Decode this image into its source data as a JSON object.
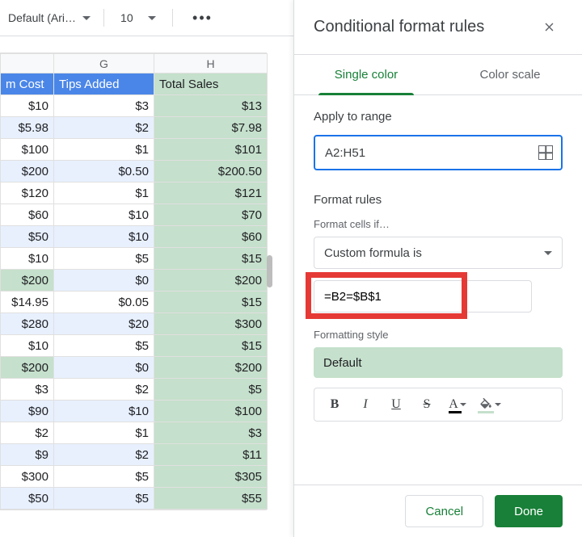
{
  "toolbar": {
    "font_label": "Default (Ari…",
    "font_size": "10"
  },
  "sheet": {
    "columns": [
      "",
      "G",
      "H"
    ],
    "header": [
      "m Cost",
      "Tips Added",
      "Total Sales"
    ],
    "rows": [
      {
        "f": "$10",
        "g": "$3",
        "h": "$13",
        "alt": false,
        "hl": []
      },
      {
        "f": "$5.98",
        "g": "$2",
        "h": "$7.98",
        "alt": true,
        "hl": []
      },
      {
        "f": "$100",
        "g": "$1",
        "h": "$101",
        "alt": false,
        "hl": []
      },
      {
        "f": "$200",
        "g": "$0.50",
        "h": "$200.50",
        "alt": true,
        "hl": []
      },
      {
        "f": "$120",
        "g": "$1",
        "h": "$121",
        "alt": false,
        "hl": []
      },
      {
        "f": "$60",
        "g": "$10",
        "h": "$70",
        "alt": false,
        "hl": []
      },
      {
        "f": "$50",
        "g": "$10",
        "h": "$60",
        "alt": true,
        "hl": []
      },
      {
        "f": "$10",
        "g": "$5",
        "h": "$15",
        "alt": false,
        "hl": []
      },
      {
        "f": "$200",
        "g": "$0",
        "h": "$200",
        "alt": true,
        "hl": [
          "f"
        ]
      },
      {
        "f": "$14.95",
        "g": "$0.05",
        "h": "$15",
        "alt": false,
        "hl": []
      },
      {
        "f": "$280",
        "g": "$20",
        "h": "$300",
        "alt": true,
        "hl": []
      },
      {
        "f": "$10",
        "g": "$5",
        "h": "$15",
        "alt": false,
        "hl": []
      },
      {
        "f": "$200",
        "g": "$0",
        "h": "$200",
        "alt": true,
        "hl": [
          "f"
        ]
      },
      {
        "f": "$3",
        "g": "$2",
        "h": "$5",
        "alt": false,
        "hl": []
      },
      {
        "f": "$90",
        "g": "$10",
        "h": "$100",
        "alt": true,
        "hl": []
      },
      {
        "f": "$2",
        "g": "$1",
        "h": "$3",
        "alt": false,
        "hl": []
      },
      {
        "f": "$9",
        "g": "$2",
        "h": "$11",
        "alt": true,
        "hl": []
      },
      {
        "f": "$300",
        "g": "$5",
        "h": "$305",
        "alt": false,
        "hl": []
      },
      {
        "f": "$50",
        "g": "$5",
        "h": "$55",
        "alt": true,
        "hl": []
      }
    ]
  },
  "panel": {
    "title": "Conditional format rules",
    "tabs": {
      "single": "Single color",
      "scale": "Color scale"
    },
    "range_title": "Apply to range",
    "range_value": "A2:H51",
    "rules_title": "Format rules",
    "cells_if": "Format cells if…",
    "condition": "Custom formula is",
    "formula": "=B2=$B$1",
    "style_title": "Formatting style",
    "style_chip": "Default",
    "format_buttons": {
      "bold": "B",
      "italic": "I",
      "underline": "U",
      "strike": "S",
      "textcolor": "A"
    },
    "cancel": "Cancel",
    "done": "Done"
  }
}
